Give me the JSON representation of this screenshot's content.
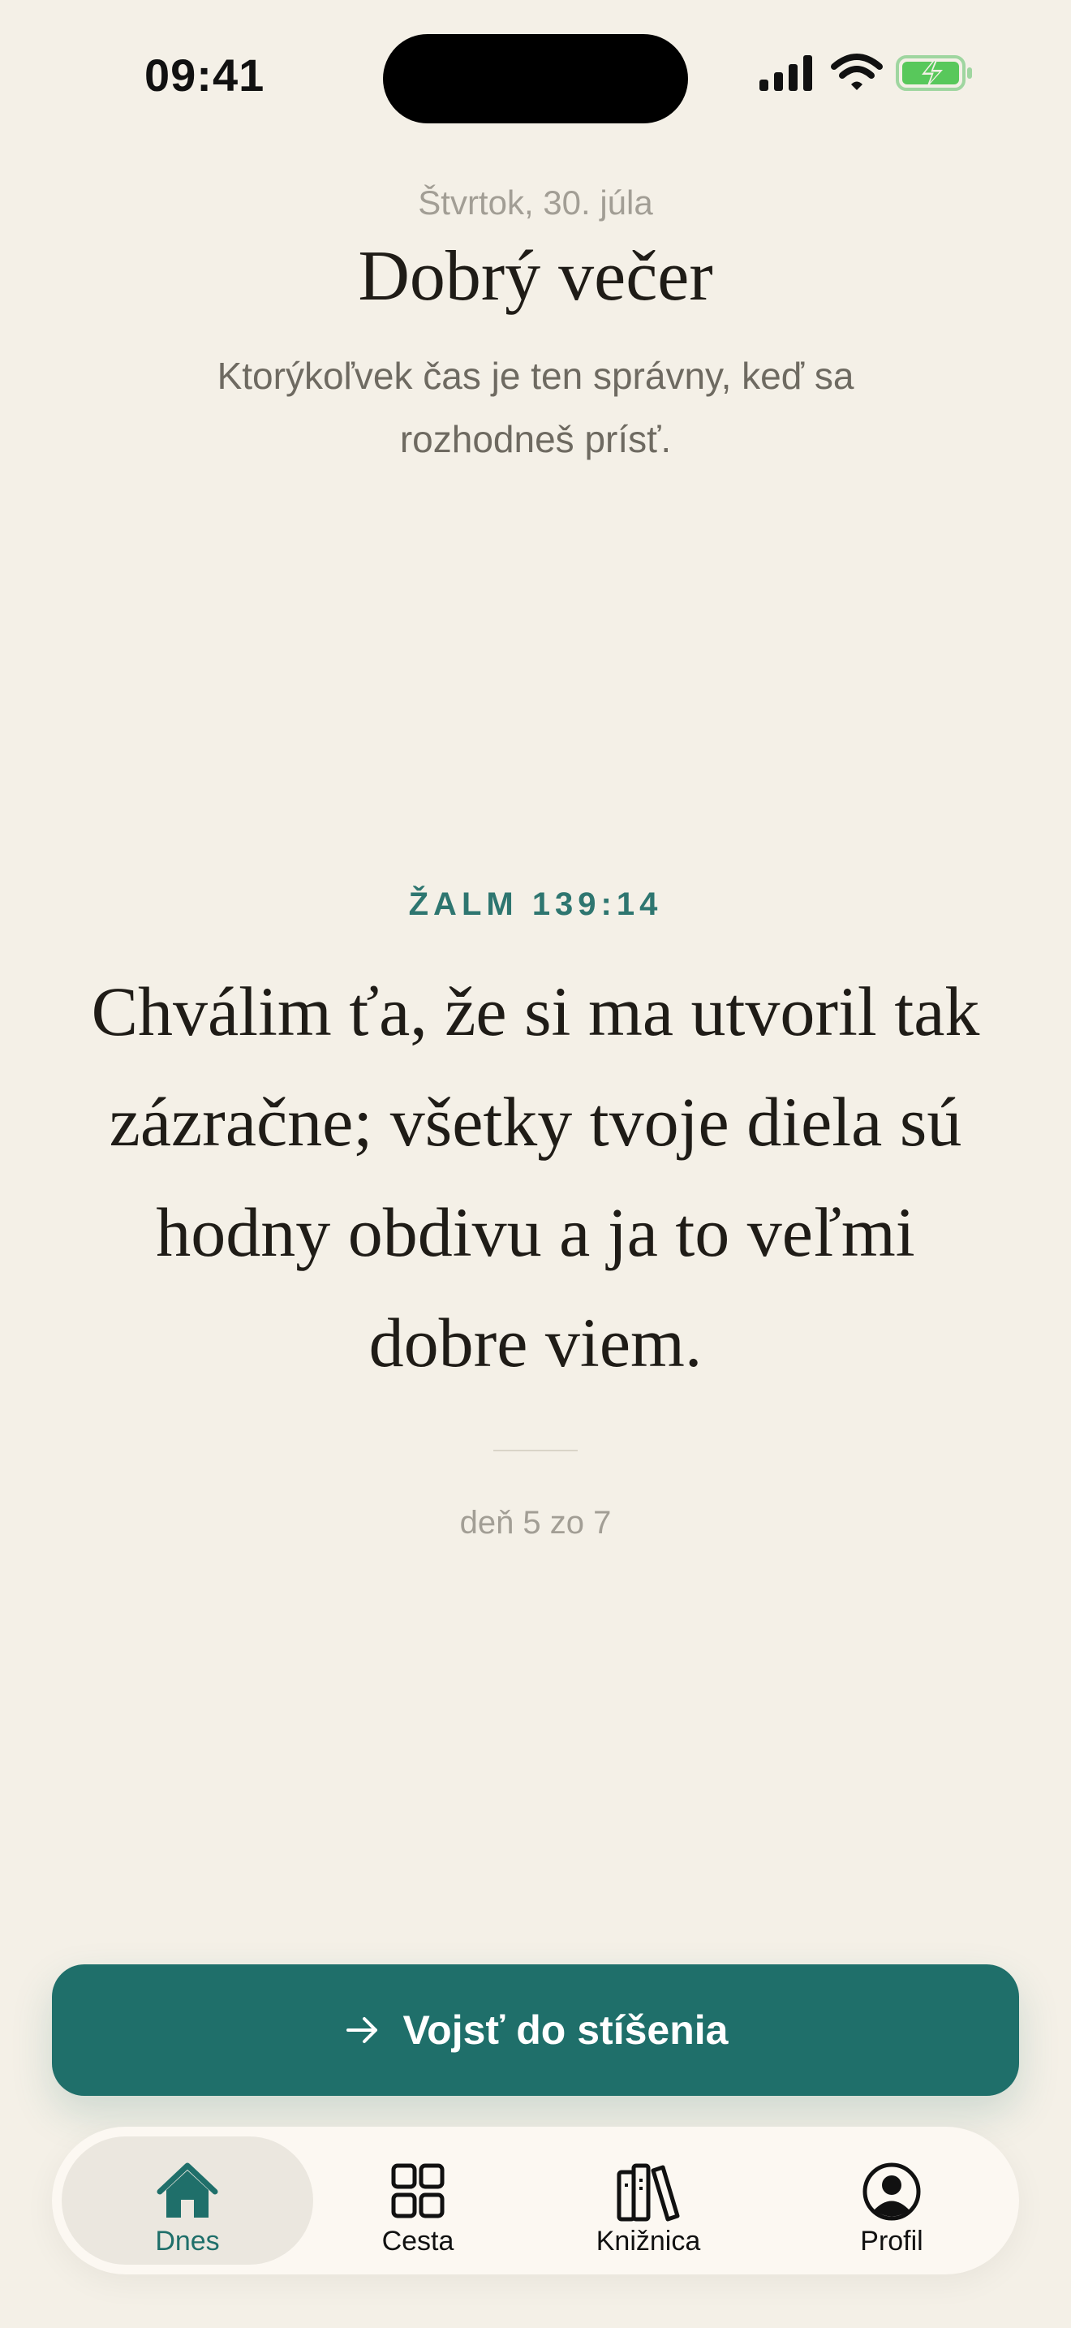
{
  "status_bar": {
    "time": "09:41"
  },
  "header": {
    "date": "Štvrtok, 30. júla",
    "greeting": "Dobrý večer",
    "subtitle": "Ktorýkoľvek čas je ten správny, keď sa rozhodneš prísť."
  },
  "verse": {
    "reference": "ŽALM 139:14",
    "text": "Chválim ťa, že si ma utvoril tak zázračne; všetky tvoje diela sú hodny obdivu a ja to veľmi dobre viem."
  },
  "progress": {
    "label": "deň 5 zo 7"
  },
  "cta": {
    "label": "Vojsť do stíšenia",
    "icon": "arrow-right-icon"
  },
  "tabs": [
    {
      "label": "Dnes",
      "icon": "home-icon",
      "active": true
    },
    {
      "label": "Cesta",
      "icon": "grid-icon",
      "active": false
    },
    {
      "label": "Knižnica",
      "icon": "books-icon",
      "active": false
    },
    {
      "label": "Profil",
      "icon": "profile-icon",
      "active": false
    }
  ],
  "colors": {
    "background": "#F4F0E7",
    "accent": "#1F6F6A",
    "battery_green": "#58C85B"
  }
}
